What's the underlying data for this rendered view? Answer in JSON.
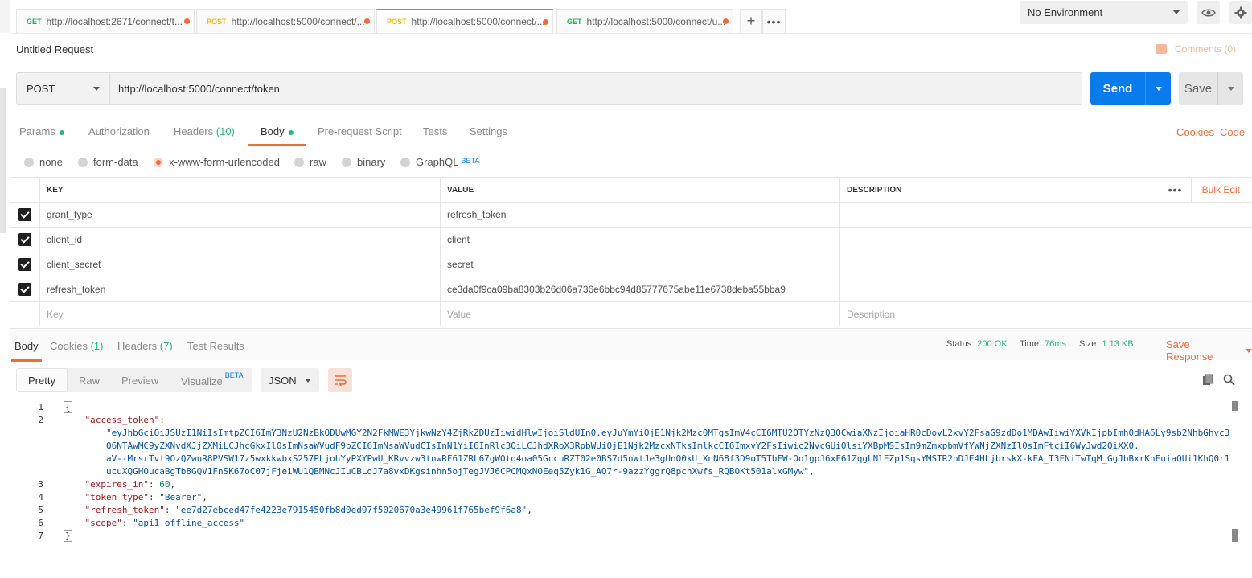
{
  "tabs": [
    {
      "method": "GET",
      "url": "http://localhost:2671/connect/t..."
    },
    {
      "method": "POST",
      "url": "http://localhost:5000/connect/..."
    },
    {
      "method": "POST",
      "url": "http://localhost:5000/connect/..."
    },
    {
      "method": "GET",
      "url": "http://localhost:5000/connect/u..."
    }
  ],
  "environment": {
    "selected": "No Environment"
  },
  "request": {
    "title": "Untitled Request",
    "comments_label": "Comments (0)",
    "method": "POST",
    "url": "http://localhost:5000/connect/token",
    "send_label": "Send",
    "save_label": "Save"
  },
  "request_tabs": {
    "params": "Params",
    "authorization": "Authorization",
    "headers": "Headers",
    "headers_count": "(10)",
    "body": "Body",
    "prerequest": "Pre-request Script",
    "tests": "Tests",
    "settings": "Settings",
    "cookies": "Cookies",
    "code": "Code"
  },
  "body_types": {
    "none": "none",
    "form_data": "form-data",
    "urlencoded": "x-www-form-urlencoded",
    "raw": "raw",
    "binary": "binary",
    "graphql": "GraphQL",
    "beta": "BETA"
  },
  "params_table": {
    "headers": {
      "key": "KEY",
      "value": "VALUE",
      "description": "DESCRIPTION"
    },
    "bulk_edit": "Bulk Edit",
    "rows": [
      {
        "key": "grant_type",
        "value": "refresh_token",
        "checked": true
      },
      {
        "key": "client_id",
        "value": "client",
        "checked": true
      },
      {
        "key": "client_secret",
        "value": "secret",
        "checked": true
      },
      {
        "key": "refresh_token",
        "value": "ce3da0f9ca09ba8303b26d06a736e6bbc94d85777675abe11e6738deba55bba9",
        "checked": true
      }
    ],
    "placeholder": {
      "key": "Key",
      "value": "Value",
      "description": "Description"
    }
  },
  "response": {
    "tabs": {
      "body": "Body",
      "cookies": "Cookies",
      "cookies_count": "(1)",
      "headers": "Headers",
      "headers_count": "(7)",
      "test_results": "Test Results"
    },
    "status_label": "Status:",
    "status_value": "200 OK",
    "time_label": "Time:",
    "time_value": "76ms",
    "size_label": "Size:",
    "size_value": "1.13 KB",
    "save_response": "Save Response",
    "view_modes": {
      "pretty": "Pretty",
      "raw": "Raw",
      "preview": "Preview",
      "visualize": "Visualize",
      "beta": "BETA"
    },
    "format": "JSON",
    "json": {
      "open_brace": "{",
      "close_brace": "}",
      "access_token_key": "\"access_token\"",
      "access_token_lines": [
        "\"eyJhbGciOiJSUzI1NiIsImtpZCI6ImY3NzU2NzBkODUwMGY2N2FkMWE3YjkwNzY4ZjRkZDUzIiwidHlwIjoiSldUIn0.eyJuYmYiOjE1Njk2Mzc0MTgsImV4cCI6MTU2OTYzNzQ3OCwiaXNzIjoiaHR0cDovL2xvY2FsaG9zdDo1MDAwIiwiYXVkIjpbImh0dHA6Ly9sb2NhbGhvc3",
        "Q6NTAwMC9yZXNvdXJjZXMiLCJhcGkxIl0sImNsaWVudF9pZCI6ImNsaWVudCIsInN1YiI6InRlc3QiLCJhdXRoX3RpbWUiOjE1Njk2MzcxNTksImlkcCI6ImxvY2FsIiwic2NvcGUiOlsiYXBpMSIsIm9mZmxpbmVfYWNjZXNzIl0sImFtciI6WyJwd2QiXX0.",
        "aV--MrsrTvt9OzQZwuR8PVSW17z5wxkkwbxS257PLjohYyPXYPwU_KRvvzw3tnwRF61ZRL67gWOtq4oa05GccuRZT02e0BS7d5nWtJe3gUnO0kU_XnN68f3D9oT5TbFW-Oo1gpJ6xF61ZqgLNlEZp1SqsYMSTR2nDJE4HLjbrskX-kFA_T3FNiTwTqM_GgJbBxrKhEuiaQUi1KhQ0r1",
        "ucuXQGHOucaBgTb8GQV1FnSK67oC07jFjeiWU1QBMNcJIuCBLdJ7a8vxDKgsinhn5ojTegJVJ6CPCMQxNOEeq5Zyk1G_AQ7r-9azzYggrQ8pchXwfs_RQBOKt501alxGMyw\","
      ],
      "expires_in_key": "\"expires_in\"",
      "expires_in_value": "60",
      "token_type_key": "\"token_type\"",
      "token_type_value": "\"Bearer\"",
      "refresh_token_key": "\"refresh_token\"",
      "refresh_token_value": "\"ee7d27ebced47fe4223e7915450fb8d0ed97f5020670a3e49961f765bef9f6a8\"",
      "scope_key": "\"scope\"",
      "scope_value": "\"api1 offline_access\""
    },
    "line_numbers": [
      "1",
      "2",
      "3",
      "4",
      "5",
      "6",
      "7"
    ]
  }
}
